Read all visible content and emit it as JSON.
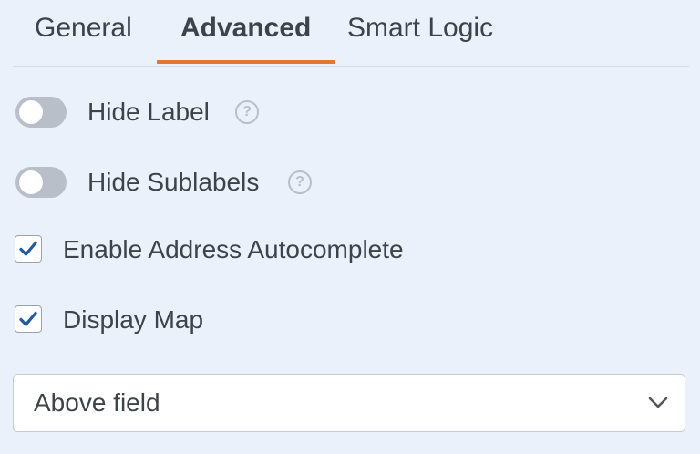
{
  "tabs": [
    {
      "label": "General",
      "active": false
    },
    {
      "label": "Advanced",
      "active": true
    },
    {
      "label": "Smart Logic",
      "active": false
    }
  ],
  "accent_color": "#e27730",
  "options": {
    "hide_label": {
      "label": "Hide Label",
      "enabled": false,
      "icon": "help-icon"
    },
    "hide_sublabels": {
      "label": "Hide Sublabels",
      "enabled": false,
      "icon": "help-icon"
    },
    "address_autocomplete": {
      "label": "Enable Address Autocomplete",
      "checked": true
    },
    "display_map": {
      "label": "Display Map",
      "checked": true
    }
  },
  "map_position": {
    "selected": "Above field",
    "icon": "chevron-down-icon"
  }
}
